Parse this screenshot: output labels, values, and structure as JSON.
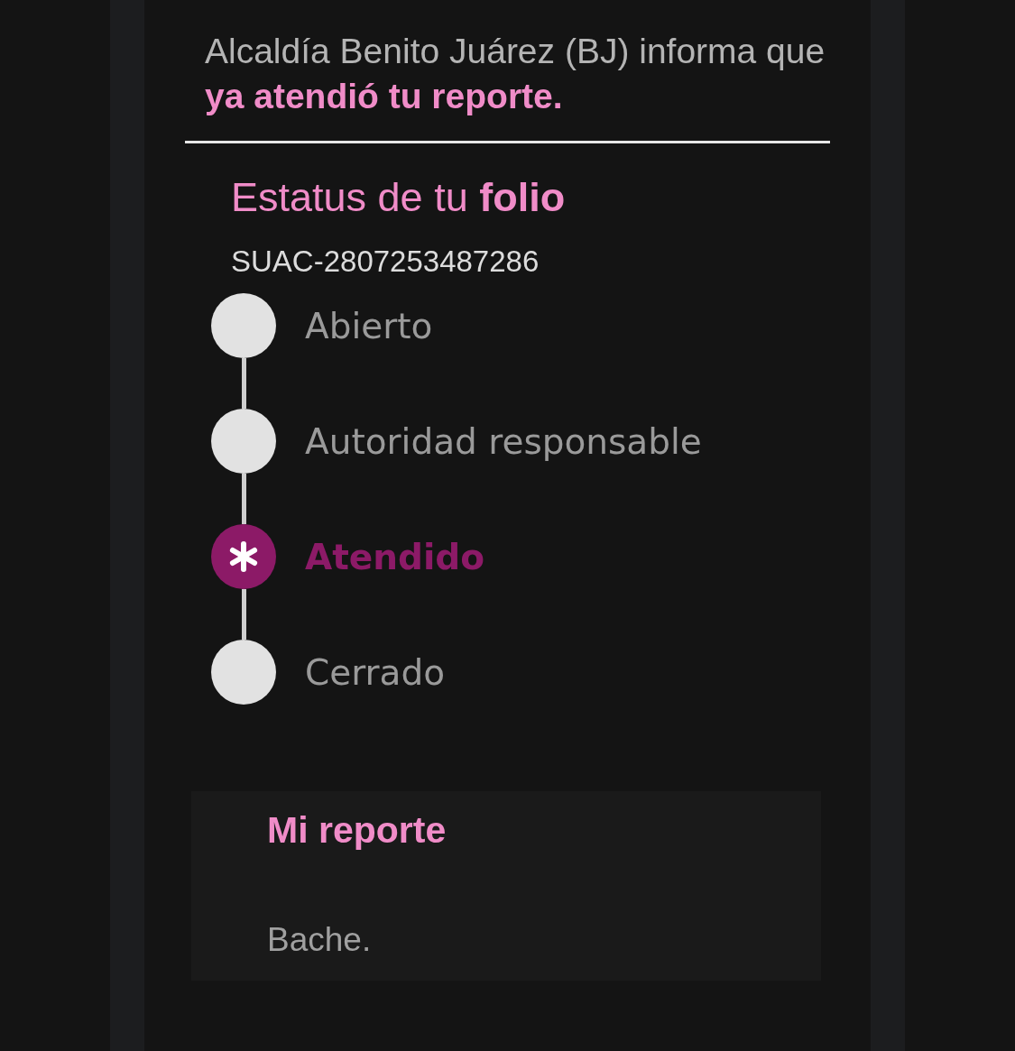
{
  "message": "Alcaldía Benito Juárez (BJ) informa que **ya atendió tu reporte.**",
  "status": {
    "title": "Estatus de tu **folio**",
    "folio": "SUAC-2807253487286",
    "steps": [
      {
        "label": "Abierto",
        "selected": false
      },
      {
        "label": "Autoridad responsable",
        "selected": false
      },
      {
        "label": "Atendido",
        "selected": true
      },
      {
        "label": "Cerrado",
        "selected": false
      }
    ]
  },
  "report": {
    "title": "Mi reporte",
    "description": "Bache."
  }
}
